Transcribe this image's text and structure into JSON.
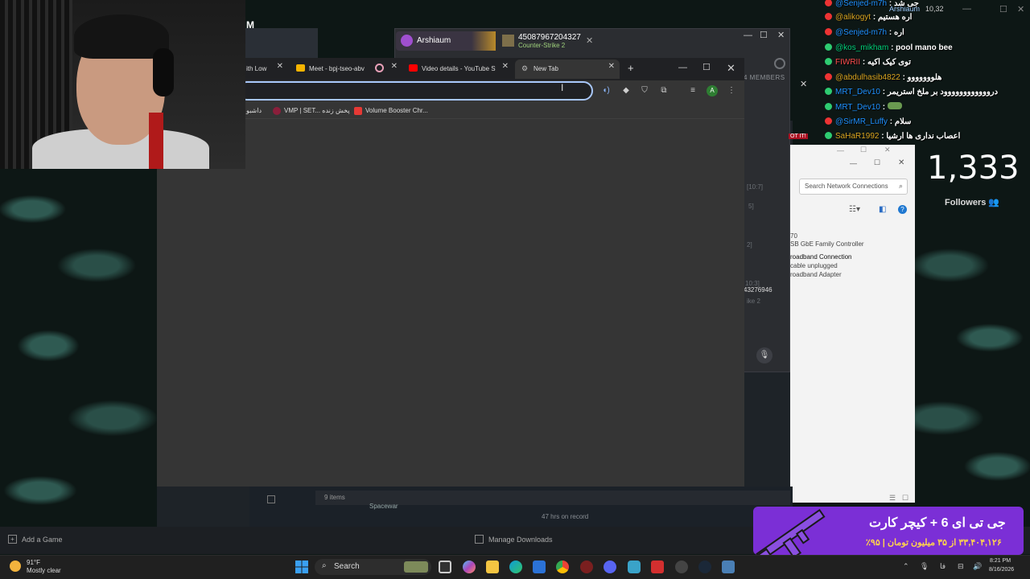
{
  "steam": {
    "logo_letter": "M",
    "items_count": "9 items",
    "game_name": "Spacewar",
    "hours": "47 hrs on record",
    "add_game": "Add a Game",
    "manage_downloads": "Manage Downloads"
  },
  "discord": {
    "tab1_label": "Arshiaum",
    "tab2_title": "45087967204327",
    "tab2_subtitle": "Counter-Strike 2",
    "members_label": "4 MEMBERS",
    "faint_texts": [
      "[10:7]",
      "5]",
      "2]",
      "10:3]",
      "43276946",
      "ike 2",
      "OT IT!"
    ]
  },
  "network": {
    "search_placeholder": "Search Network Connections",
    "line1": "70",
    "line2": "SB GbE Family Controller",
    "line3": "roadband Connection",
    "line4": "cable unplugged",
    "line5": "roadband Adapter"
  },
  "chrome": {
    "tabs": [
      {
        "label": "ith Low"
      },
      {
        "label": "Meet - bpj-tseo-abv"
      },
      {
        "label": ""
      },
      {
        "label": "Video details - YouTube St"
      },
      {
        "label": "New Tab"
      }
    ],
    "new_tab_symbol": "+",
    "bookmarks": [
      "داشبو",
      "VMP | SET... پخش زنده",
      "Volume Booster Chr..."
    ],
    "profile_initial": "A"
  },
  "chat": {
    "header_user": "Arshiaum",
    "header_viewers": "10,32",
    "messages": [
      {
        "user": "@Senjed-m7h",
        "text": ": جی شد",
        "color": "#1e90ff"
      },
      {
        "user": "@alikogyt",
        "text": ": اره هستیم",
        "color": "#daa520"
      },
      {
        "user": "@Senjed-m7h",
        "text": ": اره",
        "color": "#1e90ff"
      },
      {
        "user": "@kos_mikham",
        "text": ": pool mano bee",
        "color": "#00d27a"
      },
      {
        "user": "FIWRII",
        "text": ": توی کیک اکیه",
        "color": "#ff4d4d"
      },
      {
        "user": "@abdulhasib4822",
        "text": ": هلووووووو",
        "color": "#daa520"
      },
      {
        "user": "MRT_Dev10",
        "text": ": دروووووووووووود بر ملخ استریمر",
        "color": "#1e90ff"
      },
      {
        "user": "MRT_Dev10",
        "text": ":",
        "color": "#1e90ff"
      },
      {
        "user": "@SirMR_Luffy",
        "text": ": سلام",
        "color": "#1e90ff"
      },
      {
        "user": "SaHaR1992",
        "text": ": اعصاب نداری ها ارشیا",
        "color": "#daa520"
      }
    ],
    "followers_count": "1,333",
    "followers_label": "Followers"
  },
  "ad": {
    "title": "جی تی ای 6 + کیچر کارت",
    "subtitle": "۳۳,۴۰۴,۱۲۶ از ۳۵ میلیون تومان | ۹۵٪"
  },
  "taskbar": {
    "temperature": "91°F",
    "weather": "Mostly clear",
    "search_label": "Search",
    "time": "8:21 PM",
    "date": "8/16/2026"
  }
}
